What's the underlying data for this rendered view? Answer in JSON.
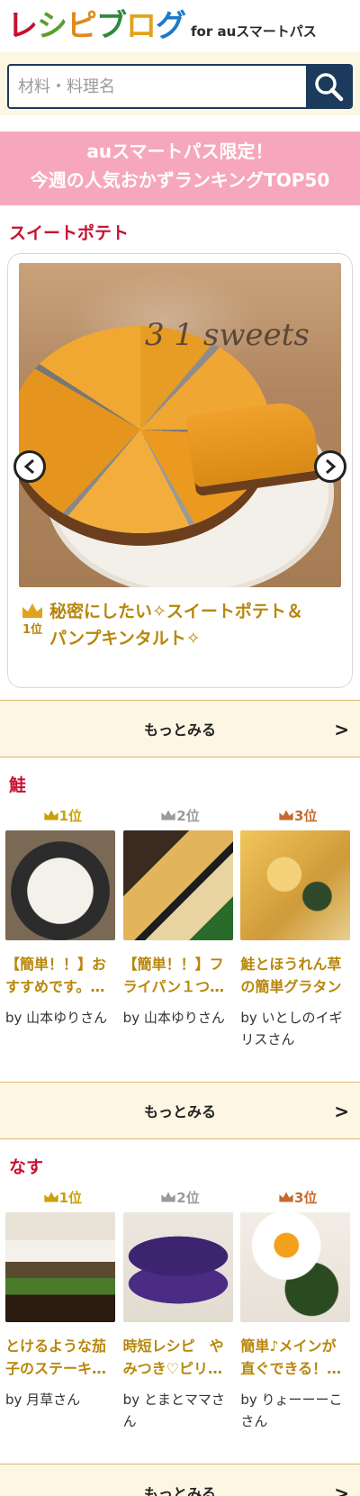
{
  "header": {
    "logo_chars": [
      {
        "char": "レ",
        "color": "#c8102e"
      },
      {
        "char": "シ",
        "color": "#5aa02c"
      },
      {
        "char": "ピ",
        "color": "#e08a1c"
      },
      {
        "char": "ブ",
        "color": "#2f8a3a"
      },
      {
        "char": "ロ",
        "color": "#e0a31c"
      },
      {
        "char": "グ",
        "color": "#1c7ac8"
      }
    ],
    "logo_suffix": "for auスマートパス"
  },
  "search": {
    "placeholder": "材料・料理名",
    "button_icon": "search-icon"
  },
  "promo": {
    "line1": "auスマートパス限定！",
    "line2": "今週の人気おかずランキングTOP50"
  },
  "sections": [
    {
      "title": "スイートポテト",
      "featured": {
        "rank": "1位",
        "title_line1": "秘密にしたい✧スイートポテト＆",
        "title_line2": "パンプキンタルト✧",
        "image_text": "3 1 sweets"
      },
      "more_label": "もっとみる"
    },
    {
      "title": "鮭",
      "items": [
        {
          "rank": "1位",
          "title_line1": "【簡単！！】お",
          "title_line2": "すすめです。…",
          "author": "by 山本ゆりさん"
        },
        {
          "rank": "2位",
          "title_line1": "【簡単！！】フ",
          "title_line2": "ライパン１つ…",
          "author": "by 山本ゆりさん"
        },
        {
          "rank": "3位",
          "title_line1": "鮭とほうれん草",
          "title_line2": "の簡単グラタン",
          "author": "by いとしのイギリスさん"
        }
      ],
      "more_label": "もっとみる"
    },
    {
      "title": "なす",
      "items": [
        {
          "rank": "1位",
          "title_line1": "とけるような茄",
          "title_line2": "子のステーキ…",
          "author": "by 月草さん"
        },
        {
          "rank": "2位",
          "title_line1": "時短レシピ　や",
          "title_line2": "みつき♡ピリ…",
          "author": "by とまとママさん"
        },
        {
          "rank": "3位",
          "title_line1": "簡単♪メインが",
          "title_line2": "直ぐできる！…",
          "author": "by りょーーーこさん"
        }
      ],
      "more_label": "もっとみる"
    }
  ],
  "colors": {
    "accent_red": "#c8102e",
    "gold": "#c9a008",
    "silver": "#9a9a9a",
    "bronze": "#c66a2c",
    "promo_pink": "#f7a7bd",
    "search_navy": "#1c3a5c"
  }
}
